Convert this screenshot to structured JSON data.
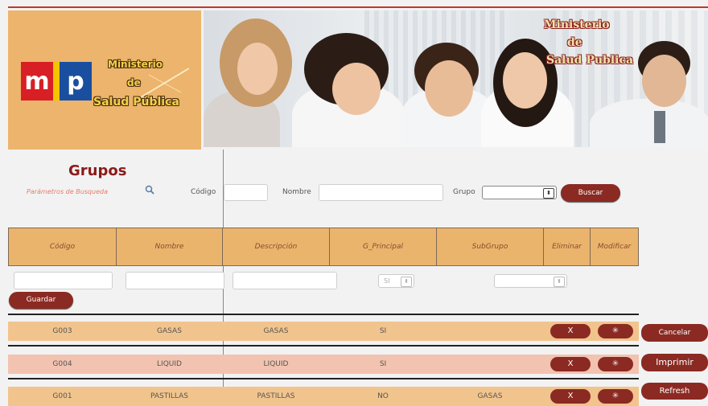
{
  "header": {
    "logo_title_1": "Ministerio",
    "logo_title_2": "de",
    "logo_title_3": "Salud Pública",
    "logo_letters": "msp",
    "banner_title_1": "Ministerio",
    "banner_title_2": "de",
    "banner_title_3": "Salud Publica"
  },
  "search": {
    "title": "Grupos",
    "subtitle": "Parámetros de Busqueda",
    "codigo_label": "Código",
    "codigo_value": "",
    "nombre_label": "Nombre",
    "nombre_value": "",
    "grupo_label": "Grupo",
    "grupo_value": "",
    "buscar_label": "Buscar"
  },
  "table": {
    "columns": [
      "Código",
      "Nombre",
      "Descripción",
      "G_Principal",
      "SubGrupo",
      "Eliminar",
      "Modificar"
    ],
    "new_row": {
      "g_principal_value": "SI",
      "subgrupo_value": "",
      "guardar_label": "Guardar"
    },
    "rows": [
      {
        "codigo": "G003",
        "nombre": "GASAS",
        "descripcion": "GASAS",
        "g_principal": "SI",
        "subgrupo": "",
        "bg": "#f2c48d"
      },
      {
        "codigo": "G004",
        "nombre": "LIQUID",
        "descripcion": "LIQUID",
        "g_principal": "SI",
        "subgrupo": "",
        "bg": "#f2c3b0"
      },
      {
        "codigo": "G001",
        "nombre": "PASTILLAS",
        "descripcion": "PASTILLAS",
        "g_principal": "NO",
        "subgrupo": "GASAS",
        "bg": "#f2c48d"
      }
    ],
    "delete_label": "X"
  },
  "side_buttons": {
    "cancelar": "Cancelar",
    "imprimir": "Imprimir",
    "refresh": "Refresh"
  },
  "colors": {
    "accent": "#8b2a22",
    "header_orange": "#ebb46d",
    "title_red": "#8b1a1a"
  }
}
